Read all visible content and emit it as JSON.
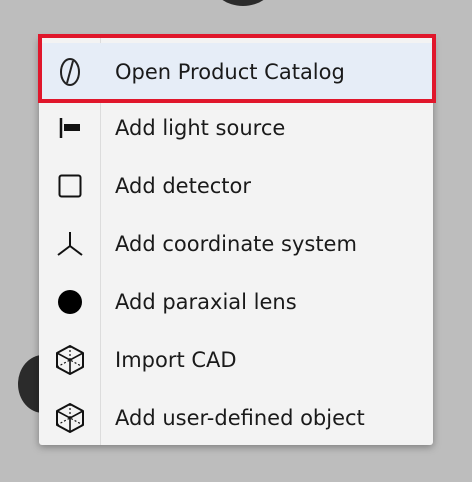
{
  "menu": {
    "items": [
      {
        "label": "Open Product Catalog",
        "icon": "lens-catalog-icon",
        "highlighted": true
      },
      {
        "label": "Add light source",
        "icon": "light-source-icon",
        "highlighted": false
      },
      {
        "label": "Add detector",
        "icon": "detector-icon",
        "highlighted": false
      },
      {
        "label": "Add coordinate system",
        "icon": "coordinate-system-icon",
        "highlighted": false
      },
      {
        "label": "Add paraxial lens",
        "icon": "paraxial-lens-icon",
        "highlighted": false
      },
      {
        "label": "Import CAD",
        "icon": "cad-cube-icon",
        "highlighted": false
      },
      {
        "label": "Add user-defined object",
        "icon": "user-object-cube-icon",
        "highlighted": false
      }
    ]
  },
  "colors": {
    "background": "#bdbdbd",
    "menu_background": "#f3f3f3",
    "highlight_background": "#e6edf7",
    "highlight_border": "#e0162b",
    "text": "#1a1a1a"
  }
}
